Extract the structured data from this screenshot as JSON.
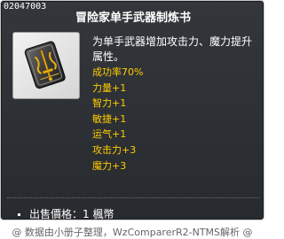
{
  "item": {
    "id": "02047003",
    "name": "冒险家单手武器制炼书",
    "description": "为单手武器增加攻击力、魔力提升属性。",
    "icon": "scroll-book-icon",
    "stats": [
      "成功率70%",
      "力量+1",
      "智力+1",
      "敏捷+1",
      "运气+1",
      "攻击力+3",
      "魔力+3"
    ],
    "price_label": "出售價格：",
    "price_value": "1 楓幣"
  },
  "credit": "@ 数据由小册子整理，WzComparerR2-NTMS解析 @",
  "colors": {
    "panel_bg": "#2d3135",
    "stat_text": "#ffcc00",
    "title_text": "#ffffff"
  }
}
